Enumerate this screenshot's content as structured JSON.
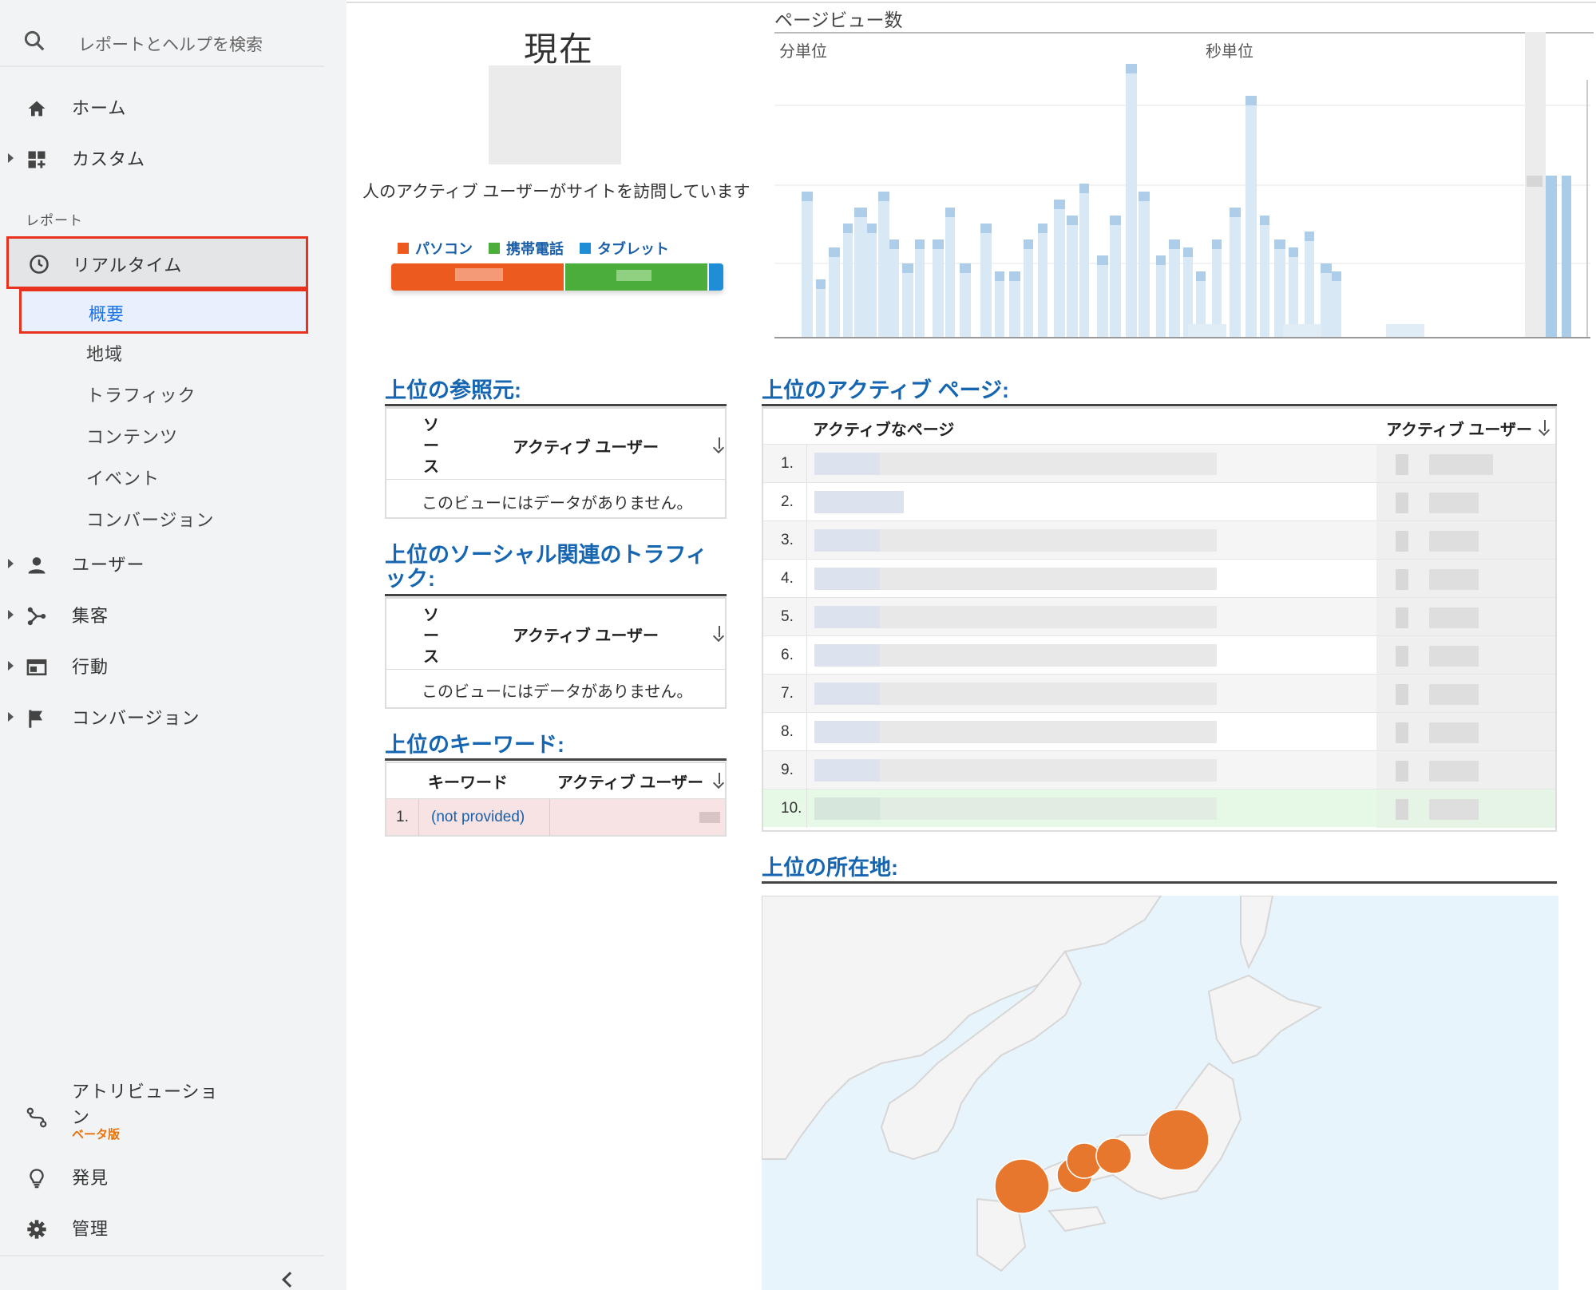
{
  "sidebar": {
    "search_placeholder": "レポートとヘルプを検索",
    "nav": {
      "home": "ホーム",
      "custom": "カスタム",
      "reports_label": "レポート",
      "realtime": "リアルタイム",
      "realtime_sub": [
        "概要",
        "地域",
        "トラフィック",
        "コンテンツ",
        "イベント",
        "コンバージョン"
      ],
      "users": "ユーザー",
      "acquisition": "集客",
      "behavior": "行動",
      "conversion": "コンバージョン",
      "attribution_line1": "アトリビューショ",
      "attribution_line2": "ン",
      "attribution_badge": "ベータ版",
      "discover": "発見",
      "admin": "管理"
    }
  },
  "now": {
    "title": "現在",
    "description": "人のアクティブ ユーザーがサイトを訪問しています",
    "legend": [
      {
        "label": "パソコン",
        "color": "#ed5a1f"
      },
      {
        "label": "携帯電話",
        "color": "#4cae3a"
      },
      {
        "label": "タブレット",
        "color": "#1f8ed6"
      }
    ]
  },
  "pageviews": {
    "title": "ページビュー数",
    "per_minute": "分単位",
    "per_second": "秒単位"
  },
  "referrals": {
    "title": "上位の参照元:",
    "col_source": "ソ\nー\nス",
    "col_users": "アクティブ ユーザー",
    "empty": "このビューにはデータがありません。"
  },
  "social": {
    "title_line1": "上位のソーシャル関連のトラフィ",
    "title_line2": "ック:",
    "col_source": "ソ\nー\nス",
    "col_users": "アクティブ ユーザー",
    "empty": "このビューにはデータがありません。"
  },
  "keywords": {
    "title": "上位のキーワード:",
    "col_keyword": "キーワード",
    "col_users": "アクティブ ユーザー",
    "rows": [
      {
        "num": "1.",
        "keyword": "(not provided)"
      }
    ]
  },
  "active_pages": {
    "title": "上位のアクティブ ページ:",
    "col_page": "アクティブなページ",
    "col_users": "アクティブ ユーザー",
    "rows": [
      "1.",
      "2.",
      "3.",
      "4.",
      "5.",
      "6.",
      "7.",
      "8.",
      "9.",
      "10."
    ]
  },
  "locations": {
    "title": "上位の所在地:"
  },
  "colors": {
    "accent": "#1a73e8",
    "highlight_border": "#e8321e",
    "section_title": "#1565b0",
    "map_bubble": "#e8772e",
    "sea": "#e8f4fc",
    "land": "#f4f4f4"
  }
}
